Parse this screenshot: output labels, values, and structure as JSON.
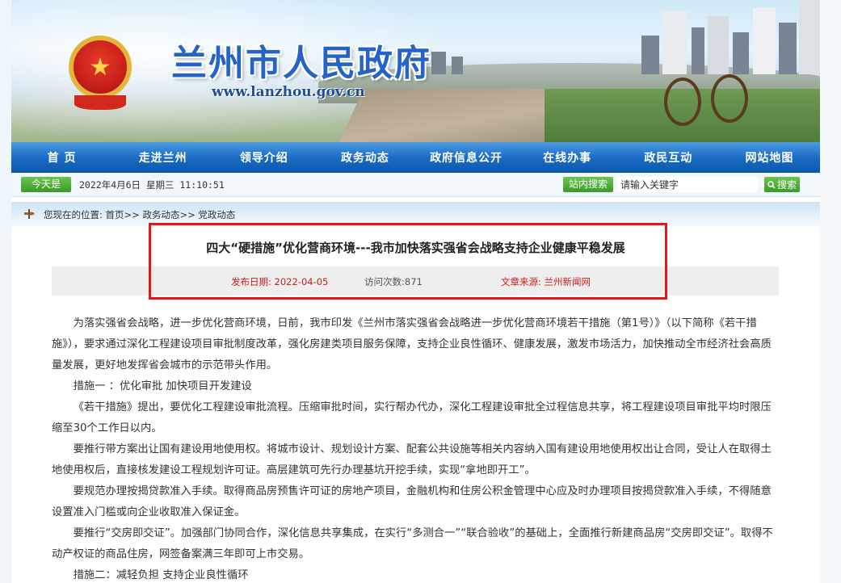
{
  "banner": {
    "title": "兰州市人民政府",
    "url": "www.lanzhou.gov.cn"
  },
  "nav": {
    "items": [
      "首 页",
      "走进兰州",
      "领导介绍",
      "政务动态",
      "政府信息公开",
      "在线办事",
      "政民互动",
      "网站地图"
    ]
  },
  "infobar": {
    "today_label": "今天是",
    "today_text": "2022年4月6日 星期三 11:10:51",
    "search_label": "站内搜索",
    "search_placeholder": "请输入关键字",
    "search_button": "搜索"
  },
  "breadcrumb": {
    "text": "您现在的位置: 首页>> 政务动态>> 党政动态"
  },
  "article": {
    "title": "四大“硬措施”优化营商环境---我市加快落实强省会战略支持企业健康平稳发展",
    "publish_date": "发布日期: 2022-04-05",
    "views": "访问次数:871",
    "source": "文章来源: 兰州新闻网",
    "paragraphs": [
      "为落实强省会战略，进一步优化营商环境，日前，我市印发《兰州市落实强省会战略进一步优化营商环境若干措施（第1号）》（以下简称《若干措施》），要求通过深化工程建设项目审批制度改革，强化房建类项目服务保障，支持企业良性循环、健康发展，激发市场活力，加快推动全市经济社会高质量发展，更好地发挥省会城市的示范带头作用。",
      "措施一 ：优化审批 加快项目开发建设",
      "《若干措施》提出，要优化工程建设审批流程。压缩审批时间，实行帮办代办，深化工程建设审批全过程信息共享，将工程建设项目审批平均时限压缩至30个工作日以内。",
      "要推行带方案出让国有建设用地使用权。将城市设计、规划设计方案、配套公共设施等相关内容纳入国有建设用地使用权出让合同，受让人在取得土地使用权后，直接核发建设工程规划许可证。高层建筑可先行办理基坑开挖手续，实现“拿地即开工”。",
      "要规范办理按揭贷款准入手续。取得商品房预售许可证的房地产项目，金融机构和住房公积金管理中心应及时办理项目按揭贷款准入手续，不得随意设置准入门槛或向企业收取准入保证金。",
      "要推行“交房即交证”。加强部门协同合作，深化信息共享集成，在实行“多测合一”“联合验收”的基础上，全面推行新建商品房“交房即交证”。取得不动产权证的商品住房，网签备案满三年即可上市交易。",
      "措施二：减轻负担 支持企业良性循环"
    ]
  },
  "colors": {
    "nav_blue": "#1a6cc4",
    "title_blue": "#2563c6",
    "badge_green": "#3a9b28",
    "highlight_red": "#e5151b",
    "meta_red": "#c8201a"
  }
}
